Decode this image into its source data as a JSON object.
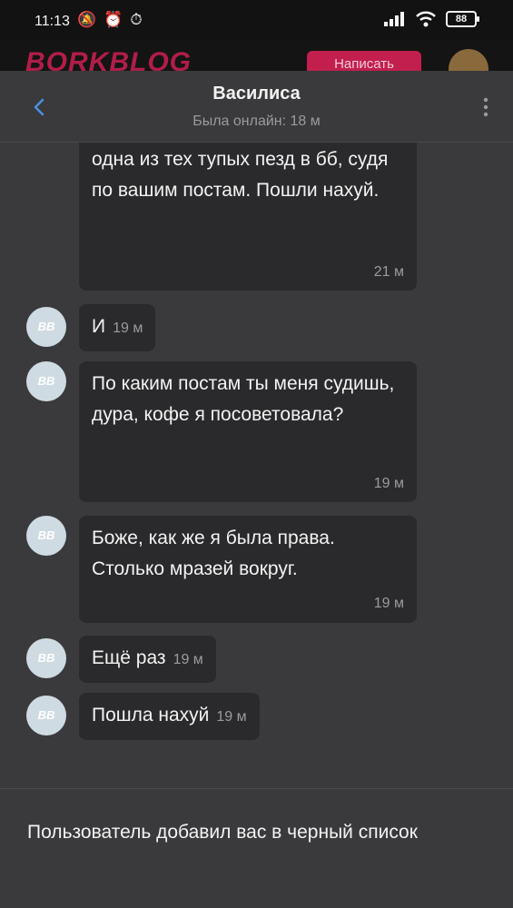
{
  "status_bar": {
    "time": "11:13",
    "battery": "88",
    "icons": [
      "mute-icon",
      "alarm-icon",
      "alarm-icon",
      "signal-icon",
      "wifi-icon",
      "battery-icon"
    ]
  },
  "background_site": {
    "logo": "BORKBLOG",
    "write_button": "Написать"
  },
  "header": {
    "name": "Василиса",
    "status": "Была онлайн: 18 м"
  },
  "messages": [
    {
      "text": "не дано понять очевидного. Вы одна из тех тупых пезд в бб, судя по вашим постам. Пошли нахуй.",
      "time": "21 м"
    },
    {
      "text": "И",
      "time": "19 м",
      "avatar": "ВВ"
    },
    {
      "text": "По каким постам ты меня судишь, дура, кофе я посоветовала?",
      "time": "19 м",
      "avatar": "ВВ"
    },
    {
      "text": "Боже, как же я была права. Столько мразей вокруг.",
      "time": "19 м",
      "avatar": "ВВ"
    },
    {
      "text": "Ещё раз",
      "time": "19 м",
      "avatar": "ВВ"
    },
    {
      "text": "Пошла нахуй",
      "time": "19 м",
      "avatar": "ВВ"
    }
  ],
  "footer": {
    "notice": "Пользователь добавил вас в черный список"
  },
  "colors": {
    "background": "#3a3a3c",
    "bubble": "#2a2a2c",
    "accent": "#4a90e2",
    "muted_text": "#9a9aa0",
    "avatar": "#cfdbe2",
    "brand": "#c21f4f"
  }
}
